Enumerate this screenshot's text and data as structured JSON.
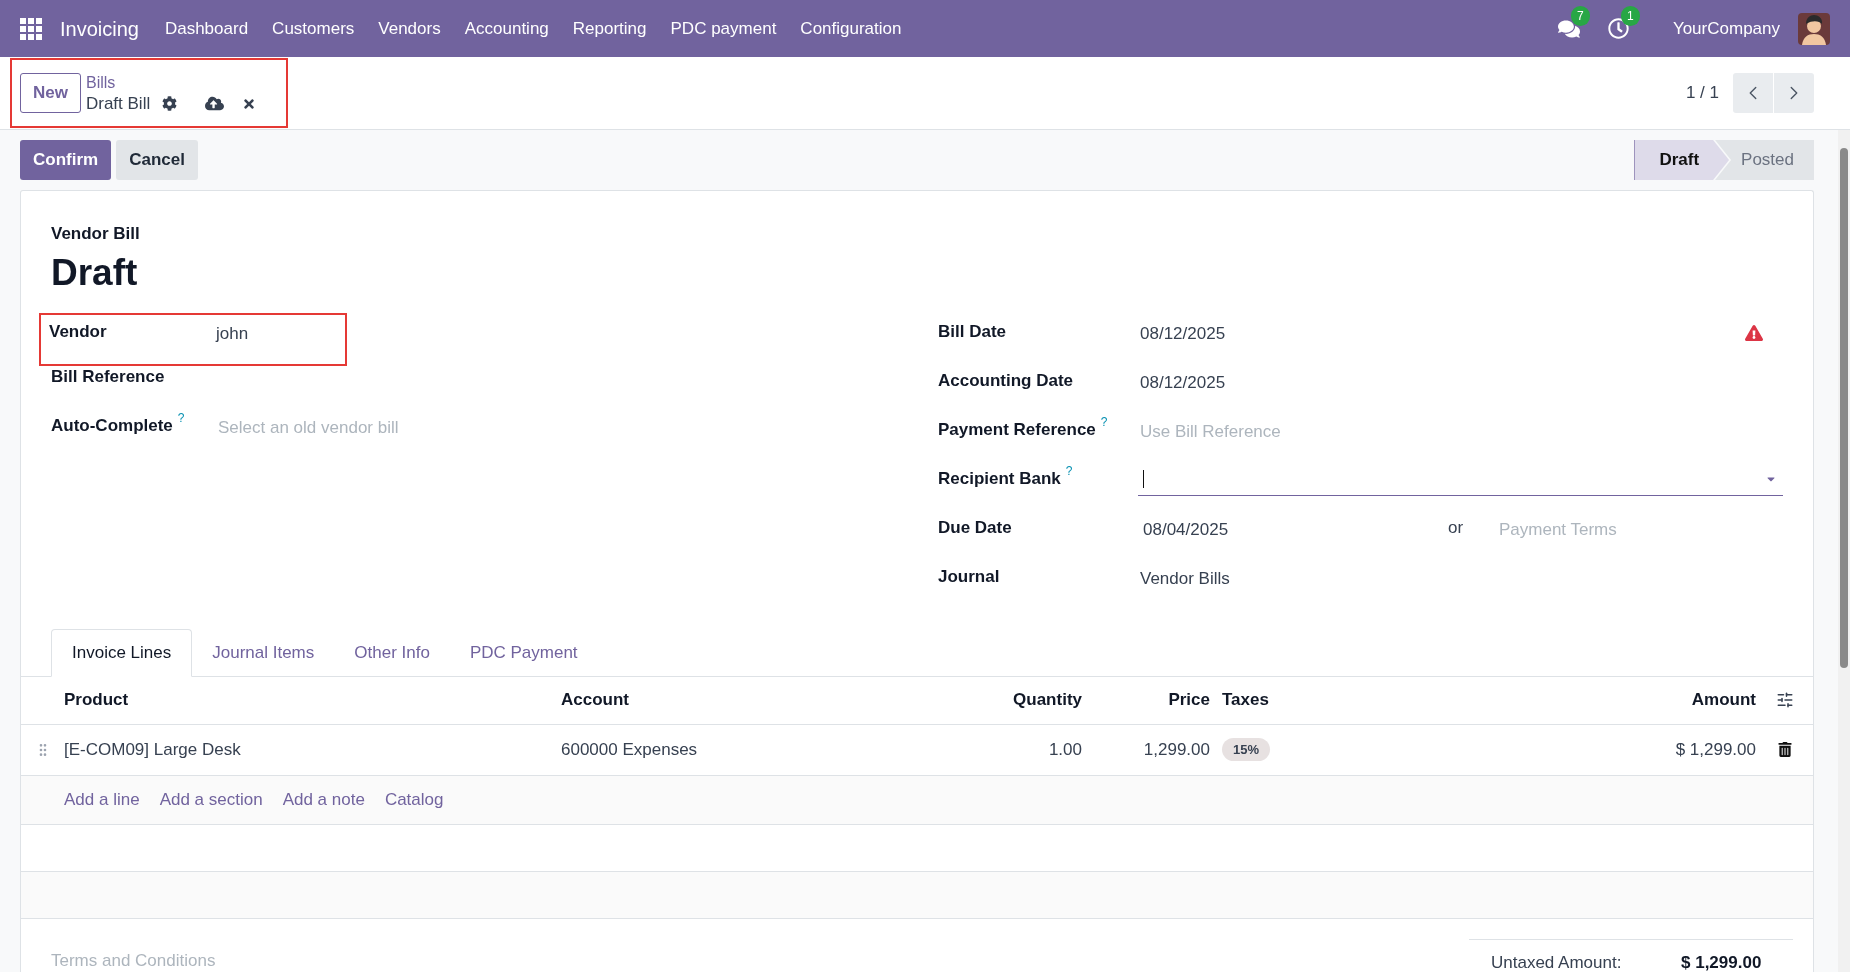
{
  "navbar": {
    "app_name": "Invoicing",
    "menu": [
      "Dashboard",
      "Customers",
      "Vendors",
      "Accounting",
      "Reporting",
      "PDC payment",
      "Configuration"
    ],
    "messages_badge": "7",
    "activities_badge": "1",
    "company": "YourCompany"
  },
  "control_panel": {
    "new_button": "New",
    "breadcrumb_parent": "Bills",
    "breadcrumb_current": "Draft Bill",
    "highlighted": true,
    "pager": "1 / 1"
  },
  "actions": [
    {
      "label": "Confirm",
      "kind": "primary"
    },
    {
      "label": "Cancel",
      "kind": "secondary"
    }
  ],
  "status_bar": [
    {
      "label": "Draft",
      "selected": true
    },
    {
      "label": "Posted",
      "selected": false
    }
  ],
  "form": {
    "subtitle": "Vendor Bill",
    "title": "Draft",
    "left_fields": [
      {
        "label": "Vendor",
        "value": "john",
        "highlighted": true
      },
      {
        "label": "Bill Reference"
      },
      {
        "label": "Auto-Complete",
        "help": "?",
        "placeholder": "Select an old vendor bill"
      }
    ],
    "right_fields": [
      {
        "kind": "text",
        "label": "Bill Date",
        "value": "08/12/2025",
        "warning": true
      },
      {
        "kind": "text",
        "label": "Accounting Date",
        "value": "08/12/2025"
      },
      {
        "kind": "text",
        "label": "Payment Reference",
        "help": "?",
        "placeholder": "Use Bill Reference"
      },
      {
        "kind": "dropdown",
        "label": "Recipient Bank",
        "help": "?",
        "focused": true
      },
      {
        "kind": "due",
        "label": "Due Date",
        "value": "08/04/2025",
        "separator": "or",
        "placeholder": "Payment Terms"
      },
      {
        "kind": "text",
        "label": "Journal",
        "value": "Vendor Bills"
      }
    ]
  },
  "tabs": [
    {
      "label": "Invoice Lines",
      "selected": true
    },
    {
      "label": "Journal Items",
      "selected": false
    },
    {
      "label": "Other Info",
      "selected": false
    },
    {
      "label": "PDC Payment",
      "selected": false
    }
  ],
  "table": {
    "columns": [
      "Product",
      "Account",
      "Quantity",
      "Price",
      "Taxes",
      "Amount"
    ],
    "rows": [
      {
        "product": "[E-COM09] Large Desk",
        "account": "600000 Expenses",
        "quantity": "1.00",
        "price": "1,299.00",
        "taxes": [
          "15%"
        ],
        "amount": "$ 1,299.00"
      }
    ],
    "add_links": [
      "Add a line",
      "Add a section",
      "Add a note",
      "Catalog"
    ]
  },
  "terms_placeholder": "Terms and Conditions",
  "totals": [
    {
      "label": "Untaxed Amount:",
      "value": "$ 1,299.00"
    }
  ]
}
